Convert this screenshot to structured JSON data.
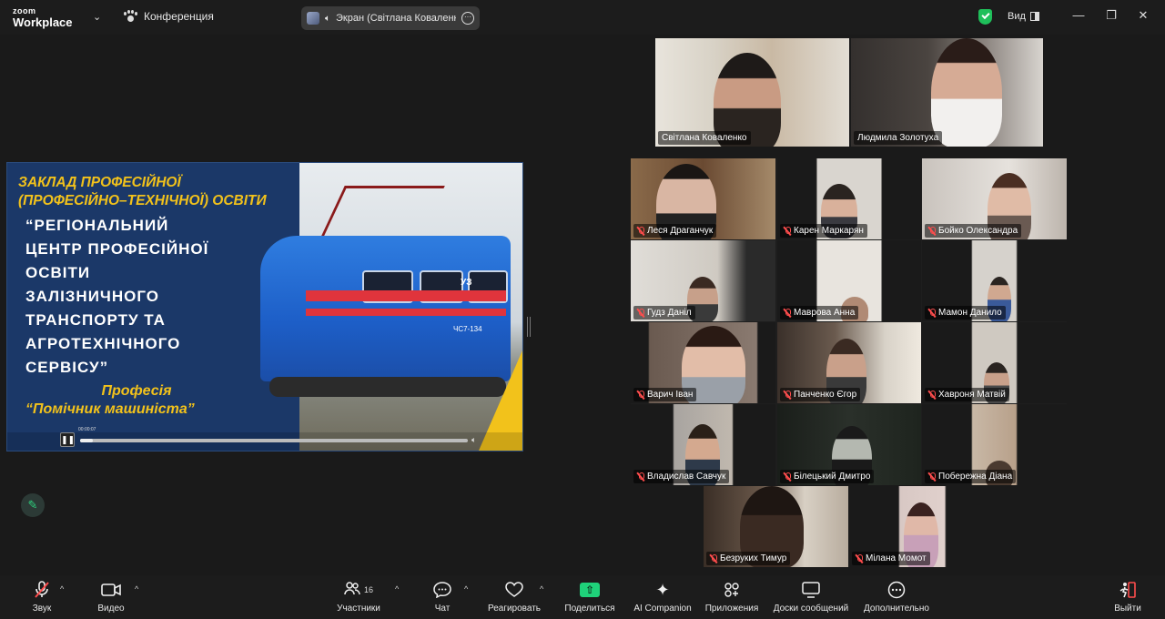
{
  "app": {
    "brand_top": "zoom",
    "brand_bottom": "Workplace",
    "meeting_name": "Конференция",
    "share_label": "Экран (Світлана Коваленко)",
    "view_label": "Вид"
  },
  "icons": {
    "meeting": "paw-icon",
    "secure": "shield-check-icon",
    "minimize": "minimize-icon",
    "restore": "restore-icon",
    "close": "close-icon"
  },
  "colors": {
    "active_speaker": "#2bd27a",
    "share_button": "#1fd27a",
    "muted": "#ff4d4d",
    "slide_accent": "#f2c21b",
    "slide_bg": "#1b3868"
  },
  "slide": {
    "heading_line1": "ЗАКЛАД ПРОФЕСІЙНОЇ",
    "heading_line2": "(ПРОФЕСІЙНО–ТЕХНІЧНОЇ) ОСВІТИ",
    "title_lines": [
      "“РЕГІОНАЛЬНИЙ",
      "ЦЕНТР ПРОФЕСІЙНОЇ",
      "ОСВІТИ",
      "ЗАЛІЗНИЧНОГО",
      "ТРАНСПОРТУ ТА",
      "АГРОТЕХНІЧНОГО",
      "СЕРВІСУ”"
    ],
    "profession_label": "Професія",
    "profession_name": "“Помічник машиніста”",
    "train_number": "ЧС7-134",
    "train_logo": "УЗ",
    "player_time": "00:00:07",
    "progress_percent": 3.3
  },
  "participants_top": [
    {
      "name": "Світлана Коваленко",
      "muted": false,
      "active": true
    },
    {
      "name": "Людмила Золотуха",
      "muted": false,
      "active": false
    }
  ],
  "participants_grid": [
    {
      "name": "Леся Драганчук",
      "muted": true
    },
    {
      "name": "Карен Маркарян",
      "muted": true
    },
    {
      "name": "Бойко Олександра",
      "muted": true
    },
    {
      "name": "Гудз Даніл",
      "muted": true
    },
    {
      "name": "Маврова Анна",
      "muted": true
    },
    {
      "name": "Мамон Данило",
      "muted": true
    },
    {
      "name": "Варич Іван",
      "muted": true
    },
    {
      "name": "Панченко Єгор",
      "muted": true
    },
    {
      "name": "Хавроня Матвій",
      "muted": true
    },
    {
      "name": "Владислав Савчук",
      "muted": true
    },
    {
      "name": "Білецький Дмитро",
      "muted": true
    },
    {
      "name": "Побережна Діана",
      "muted": true
    },
    {
      "name": "Безруких Тимур",
      "muted": true
    },
    {
      "name": "Мілана Момот",
      "muted": true
    }
  ],
  "toolbar": {
    "audio": "Звук",
    "video": "Видео",
    "participants": "Участники",
    "participants_count": "16",
    "chat": "Чат",
    "react": "Реагировать",
    "share": "Поделиться",
    "ai": "AI Companion",
    "apps": "Приложения",
    "whiteboards": "Доски сообщений",
    "more": "Дополнительно",
    "leave": "Выйти"
  }
}
